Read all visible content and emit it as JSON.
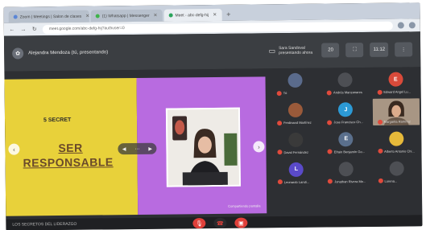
{
  "browser": {
    "tabs": [
      {
        "label": "Zoom | Meetings | Salon de clases",
        "active": false
      },
      {
        "label": "(1) Whatsapp | Messenger",
        "active": false
      },
      {
        "label": "Meet - abc-defg-hij",
        "active": true
      }
    ],
    "new_tab": "+",
    "url": "meet.google.com/abc-defg-hij?authuser=0",
    "back": "←",
    "forward": "→",
    "reload": "↻"
  },
  "meeting": {
    "host_title": "Alejandra Mendoza (tú, presentando)",
    "recording_text": "Sara Sandoval presentando ahora",
    "time": "11:12",
    "buttons": [
      "20",
      "⛶",
      "⋮"
    ]
  },
  "slide": {
    "secret_label": "5 SECRET",
    "title_line1": "SER",
    "title_line2": "RESPONSABLE",
    "controls": [
      "◀",
      "⋯",
      "▶"
    ],
    "prev": "‹",
    "next": "›",
    "share_label": "Compartiendo pantalla"
  },
  "participants": [
    {
      "name": "Tú",
      "initial": "",
      "color": "#5a6b8c",
      "kind": "logo"
    },
    {
      "name": "Andrés Manzanares",
      "initial": "",
      "color": "#4d4f54",
      "kind": "photo"
    },
    {
      "name": "Edward Angel Lu...",
      "initial": "E",
      "color": "#d94a3a",
      "kind": "letter"
    },
    {
      "name": "Ferdinand Martínez",
      "initial": "",
      "color": "#9a5a3a",
      "kind": "photo"
    },
    {
      "name": "Jose Francisco Ch...",
      "initial": "J",
      "color": "#2c9ad6",
      "kind": "letter"
    },
    {
      "name": "Margarita Ramírez",
      "initial": "",
      "color": "#9a8a78",
      "kind": "camera"
    },
    {
      "name": "David Fernández",
      "initial": "",
      "color": "#3a3a3a",
      "kind": "photo"
    },
    {
      "name": "Efrain Benjamín Go...",
      "initial": "E",
      "color": "#5a6f8c",
      "kind": "letter"
    },
    {
      "name": "Alberto Antonio Chi...",
      "initial": "",
      "color": "#e6b93a",
      "kind": "photo"
    },
    {
      "name": "Leonardo Landi...",
      "initial": "L",
      "color": "#5a4ac9",
      "kind": "letter"
    },
    {
      "name": "Jonathan Rivera Me...",
      "initial": "",
      "color": "#4d4f54",
      "kind": "photo"
    },
    {
      "name": "Lorena...",
      "initial": "",
      "color": "#4d4f54",
      "kind": "photo"
    }
  ],
  "bottom": {
    "label": "LOS SECRETOS DEL LIDERAZGO",
    "mic": "🎙",
    "hangup": "☎",
    "cam": "▣"
  },
  "colors": {
    "slide_yellow": "#e8d13a",
    "slide_purple": "#b86be0",
    "mute_red": "#e04a3c"
  }
}
